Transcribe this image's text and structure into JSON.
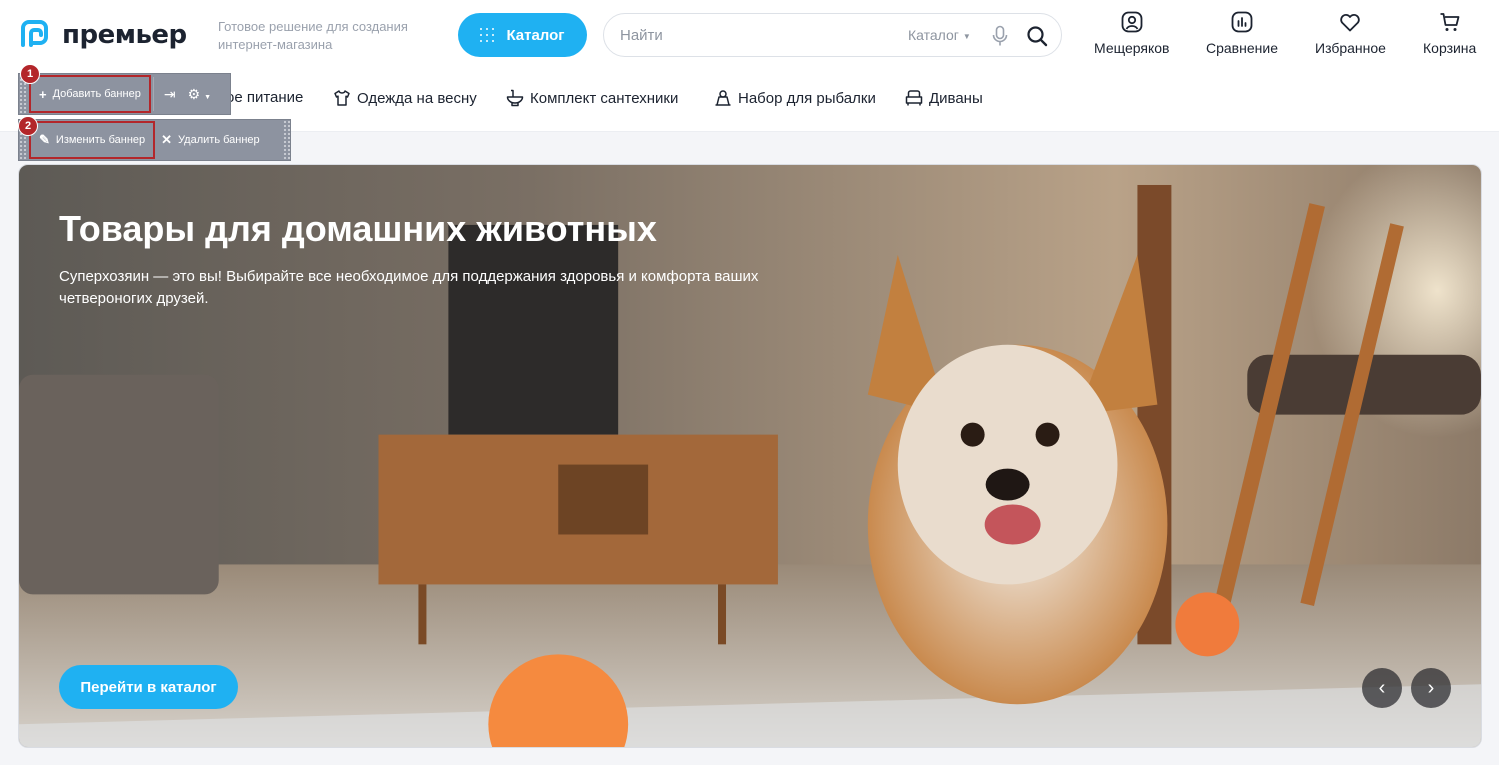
{
  "brand": {
    "name": "премьер",
    "tagline": "Готовое решение для создания интернет-магазина"
  },
  "header": {
    "catalog_label": "Каталог",
    "search": {
      "placeholder": "Найти",
      "scope": "Каталог"
    },
    "actions": [
      {
        "label": "Мещеряков",
        "icon": "user-icon"
      },
      {
        "label": "Сравнение",
        "icon": "compare-icon"
      },
      {
        "label": "Избранное",
        "icon": "heart-icon"
      },
      {
        "label": "Корзина",
        "icon": "cart-icon"
      }
    ]
  },
  "nav": {
    "items": [
      {
        "label": "ое питание",
        "icon": ""
      },
      {
        "label": "Одежда на весну",
        "icon": "shirt-icon"
      },
      {
        "label": "Комплект сантехники",
        "icon": "toilet-icon"
      },
      {
        "label": "Набор для рыбалки",
        "icon": "fishing-icon"
      },
      {
        "label": "Диваны",
        "icon": "sofa-icon"
      }
    ]
  },
  "admin_toolbar": {
    "add_banner": "Добавить баннер",
    "edit_banner": "Изменить баннер",
    "delete_banner": "Удалить баннер",
    "markers": [
      "1",
      "2"
    ]
  },
  "banner": {
    "title": "Товары для домашних животных",
    "text": "Суперхозяин — это вы! Выбирайте все необходимое для поддержания здоровья и комфорта ваших четвероногих друзей.",
    "cta": "Перейти в каталог",
    "prev": "‹",
    "next": "›"
  },
  "colors": {
    "accent": "#1fb1f2",
    "marker": "#b3262a",
    "toolbar": "#8d93a0"
  }
}
